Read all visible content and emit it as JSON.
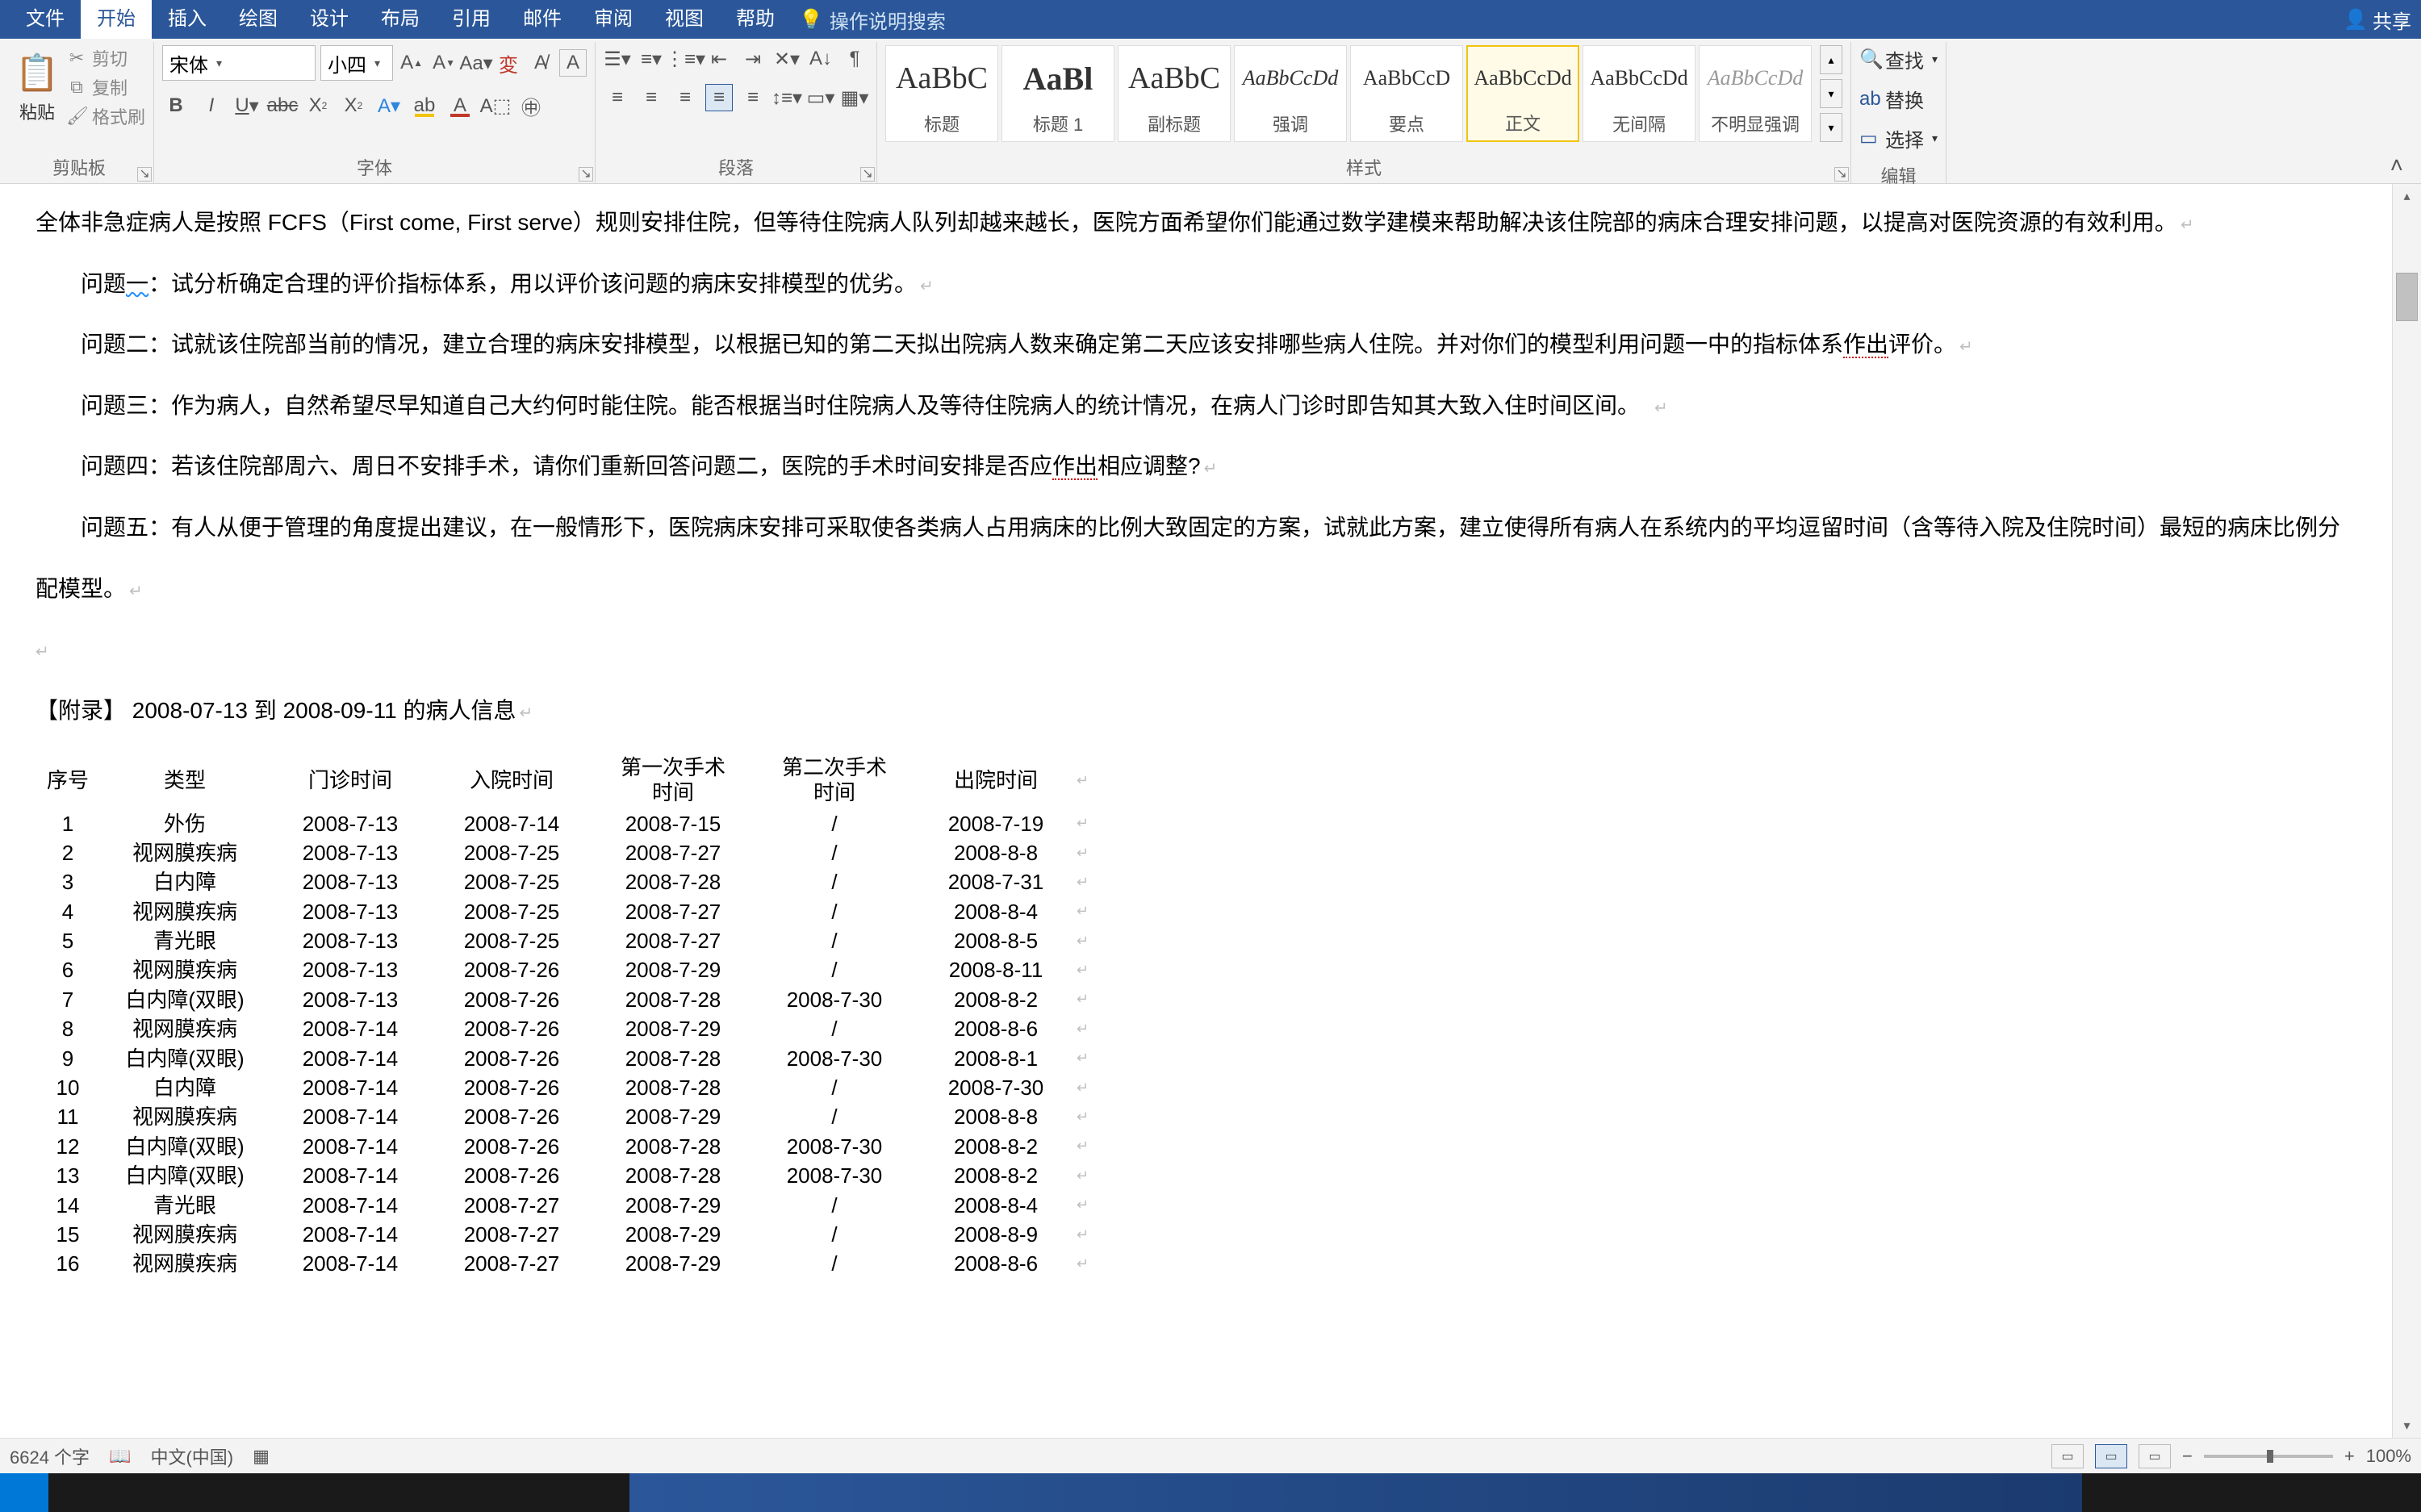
{
  "menus": [
    "文件",
    "开始",
    "插入",
    "绘图",
    "设计",
    "布局",
    "引用",
    "邮件",
    "审阅",
    "视图",
    "帮助"
  ],
  "active_menu": "开始",
  "tellme": "操作说明搜索",
  "share": "共享",
  "clipboard": {
    "paste": "粘贴",
    "cut": "剪切",
    "copy": "复制",
    "format_painter": "格式刷",
    "label": "剪贴板"
  },
  "font": {
    "name": "宋体",
    "size": "小四",
    "label": "字体"
  },
  "paragraph": {
    "label": "段落"
  },
  "styles": {
    "label": "样式",
    "items": [
      {
        "preview": "AaBbC",
        "name": "标题",
        "big": true
      },
      {
        "preview": "AaBl",
        "name": "标题 1",
        "bold": true
      },
      {
        "preview": "AaBbC",
        "name": "副标题",
        "big": true
      },
      {
        "preview": "AaBbCcDd",
        "name": "强调",
        "italic": true
      },
      {
        "preview": "AaBbCcD",
        "name": "要点"
      },
      {
        "preview": "AaBbCcDd",
        "name": "正文",
        "selected": true
      },
      {
        "preview": "AaBbCcDd",
        "name": "无间隔"
      },
      {
        "preview": "AaBbCcDd",
        "name": "不明显强调",
        "italic": true,
        "gray": true
      }
    ]
  },
  "editing": {
    "label": "编辑",
    "find": "查找",
    "replace": "替换",
    "select": "选择"
  },
  "body": {
    "p0": "全体非急症病人是按照 FCFS（First come, First serve）规则安排住院，但等待住院病人队列却越来越长，医院方面希望你们能通过数学建模来帮助解决该住院部的病床合理安排问题，以提高对医院资源的有效利用。",
    "q1_lbl": "问题",
    "q1_no": "一",
    "q1_txt": "：试分析确定合理的评价指标体系，用以评价该问题的病床安排模型的优劣。",
    "q2": "问题二：试就该住院部当前的情况，建立合理的病床安排模型，以根据已知的第二天拟出院病人数来确定第二天应该安排哪些病人住院。并对你们的模型利用问题一中的指标体系",
    "q2_b": "作出",
    "q2_c": "评价。",
    "q3": "问题三：作为病人，自然希望尽早知道自己大约何时能住院。能否根据当时住院病人及等待住院病人的统计情况，在病人门诊时即告知其大致入住时间区间。",
    "q4a": "问题四：若该住院部周六、周日不安排手术，请你们重新回答问题二，医院的手术时间安排是否应",
    "q4b": "作出",
    "q4c": "相应调整?",
    "q5": "问题五：有人从便于管理的角度提出建议，在一般情形下，医院病床安排可采取使各类病人占用病床的比例大致固定的方案，试就此方案，建立使得所有病人在系统内的平均逗留时间（含等待入院及住院时间）最短的病床比例分配模型。",
    "appendix": "【附录】  2008-07-13 到 2008-09-11 的病人信息"
  },
  "table": {
    "headers": [
      "序号",
      "类型",
      "门诊时间",
      "入院时间",
      "第一次手术时间",
      "第二次手术时间",
      "出院时间"
    ],
    "rows": [
      [
        "1",
        "外伤",
        "2008-7-13",
        "2008-7-14",
        "2008-7-15",
        "/",
        "2008-7-19"
      ],
      [
        "2",
        "视网膜疾病",
        "2008-7-13",
        "2008-7-25",
        "2008-7-27",
        "/",
        "2008-8-8"
      ],
      [
        "3",
        "白内障",
        "2008-7-13",
        "2008-7-25",
        "2008-7-28",
        "/",
        "2008-7-31"
      ],
      [
        "4",
        "视网膜疾病",
        "2008-7-13",
        "2008-7-25",
        "2008-7-27",
        "/",
        "2008-8-4"
      ],
      [
        "5",
        "青光眼",
        "2008-7-13",
        "2008-7-25",
        "2008-7-27",
        "/",
        "2008-8-5"
      ],
      [
        "6",
        "视网膜疾病",
        "2008-7-13",
        "2008-7-26",
        "2008-7-29",
        "/",
        "2008-8-11"
      ],
      [
        "7",
        "白内障(双眼)",
        "2008-7-13",
        "2008-7-26",
        "2008-7-28",
        "2008-7-30",
        "2008-8-2"
      ],
      [
        "8",
        "视网膜疾病",
        "2008-7-14",
        "2008-7-26",
        "2008-7-29",
        "/",
        "2008-8-6"
      ],
      [
        "9",
        "白内障(双眼)",
        "2008-7-14",
        "2008-7-26",
        "2008-7-28",
        "2008-7-30",
        "2008-8-1"
      ],
      [
        "10",
        "白内障",
        "2008-7-14",
        "2008-7-26",
        "2008-7-28",
        "/",
        "2008-7-30"
      ],
      [
        "11",
        "视网膜疾病",
        "2008-7-14",
        "2008-7-26",
        "2008-7-29",
        "/",
        "2008-8-8"
      ],
      [
        "12",
        "白内障(双眼)",
        "2008-7-14",
        "2008-7-26",
        "2008-7-28",
        "2008-7-30",
        "2008-8-2"
      ],
      [
        "13",
        "白内障(双眼)",
        "2008-7-14",
        "2008-7-26",
        "2008-7-28",
        "2008-7-30",
        "2008-8-2"
      ],
      [
        "14",
        "青光眼",
        "2008-7-14",
        "2008-7-27",
        "2008-7-29",
        "/",
        "2008-8-4"
      ],
      [
        "15",
        "视网膜疾病",
        "2008-7-14",
        "2008-7-27",
        "2008-7-29",
        "/",
        "2008-8-9"
      ],
      [
        "16",
        "视网膜疾病",
        "2008-7-14",
        "2008-7-27",
        "2008-7-29",
        "/",
        "2008-8-6"
      ]
    ]
  },
  "status": {
    "words": "6624 个字",
    "lang": "中文(中国)",
    "zoom": "100%"
  }
}
